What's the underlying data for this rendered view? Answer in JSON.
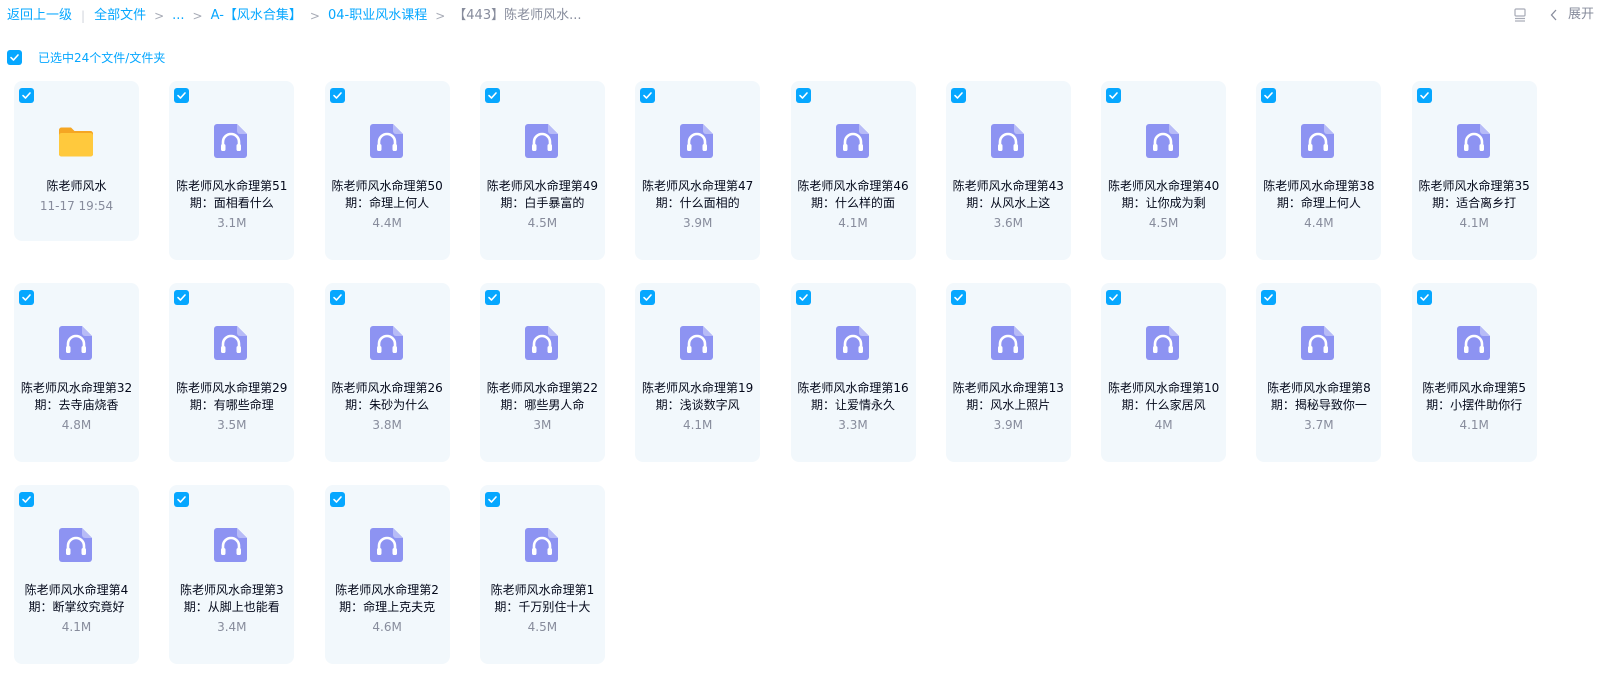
{
  "breadcrumb": {
    "back": "返回上一级",
    "all_files": "全部文件",
    "ellipsis": "...",
    "level1": "A-【风水合集】",
    "level2": "04-职业风水课程",
    "current": "【443】陈老师风水..."
  },
  "toolbar": {
    "expand": "展开",
    "list_icon": "list-view-icon",
    "chevron_icon": "chevron-left-icon"
  },
  "selection": {
    "text": "已选中24个文件/文件夹",
    "checked": true
  },
  "colors": {
    "accent": "#06a7ff",
    "card_bg": "#f2f8fc",
    "audio_icon": "#8d93f2",
    "folder": "#ffc53d"
  },
  "files": [
    {
      "type": "folder",
      "name": "陈老师风水",
      "meta": "11-17 19:54",
      "icon": "folder-icon"
    },
    {
      "type": "audio",
      "name": "陈老师风水命理第51期：面相看什么",
      "meta": "3.1M",
      "icon": "audio-file-icon"
    },
    {
      "type": "audio",
      "name": "陈老师风水命理第50期：命理上何人",
      "meta": "4.4M",
      "icon": "audio-file-icon"
    },
    {
      "type": "audio",
      "name": "陈老师风水命理第49期：白手暴富的",
      "meta": "4.5M",
      "icon": "audio-file-icon"
    },
    {
      "type": "audio",
      "name": "陈老师风水命理第47期：什么面相的",
      "meta": "3.9M",
      "icon": "audio-file-icon"
    },
    {
      "type": "audio",
      "name": "陈老师风水命理第46期：什么样的面",
      "meta": "4.1M",
      "icon": "audio-file-icon"
    },
    {
      "type": "audio",
      "name": "陈老师风水命理第43期：从风水上这",
      "meta": "3.6M",
      "icon": "audio-file-icon"
    },
    {
      "type": "audio",
      "name": "陈老师风水命理第40期：让你成为剩",
      "meta": "4.5M",
      "icon": "audio-file-icon"
    },
    {
      "type": "audio",
      "name": "陈老师风水命理第38期：命理上何人",
      "meta": "4.4M",
      "icon": "audio-file-icon"
    },
    {
      "type": "audio",
      "name": "陈老师风水命理第35期：适合离乡打",
      "meta": "4.1M",
      "icon": "audio-file-icon"
    },
    {
      "type": "audio",
      "name": "陈老师风水命理第32期：去寺庙烧香",
      "meta": "4.8M",
      "icon": "audio-file-icon"
    },
    {
      "type": "audio",
      "name": "陈老师风水命理第29期：有哪些命理",
      "meta": "3.5M",
      "icon": "audio-file-icon"
    },
    {
      "type": "audio",
      "name": "陈老师风水命理第26期：朱砂为什么",
      "meta": "3.8M",
      "icon": "audio-file-icon"
    },
    {
      "type": "audio",
      "name": "陈老师风水命理第22期：哪些男人命",
      "meta": "3M",
      "icon": "audio-file-icon"
    },
    {
      "type": "audio",
      "name": "陈老师风水命理第19期：浅谈数字风",
      "meta": "4.1M",
      "icon": "audio-file-icon"
    },
    {
      "type": "audio",
      "name": "陈老师风水命理第16期：让爱情永久",
      "meta": "3.3M",
      "icon": "audio-file-icon"
    },
    {
      "type": "audio",
      "name": "陈老师风水命理第13期：风水上照片",
      "meta": "3.9M",
      "icon": "audio-file-icon"
    },
    {
      "type": "audio",
      "name": "陈老师风水命理第10期：什么家居风",
      "meta": "4M",
      "icon": "audio-file-icon"
    },
    {
      "type": "audio",
      "name": "陈老师风水命理第8期：揭秘导致你一",
      "meta": "3.7M",
      "icon": "audio-file-icon"
    },
    {
      "type": "audio",
      "name": "陈老师风水命理第5期：小摆件助你行",
      "meta": "4.1M",
      "icon": "audio-file-icon"
    },
    {
      "type": "audio",
      "name": "陈老师风水命理第4期：断掌纹究竟好",
      "meta": "4.1M",
      "icon": "audio-file-icon"
    },
    {
      "type": "audio",
      "name": "陈老师风水命理第3期：从脚上也能看",
      "meta": "3.4M",
      "icon": "audio-file-icon"
    },
    {
      "type": "audio",
      "name": "陈老师风水命理第2期：命理上克夫克",
      "meta": "4.6M",
      "icon": "audio-file-icon"
    },
    {
      "type": "audio",
      "name": "陈老师风水命理第1期：千万别住十大",
      "meta": "4.5M",
      "icon": "audio-file-icon"
    }
  ]
}
